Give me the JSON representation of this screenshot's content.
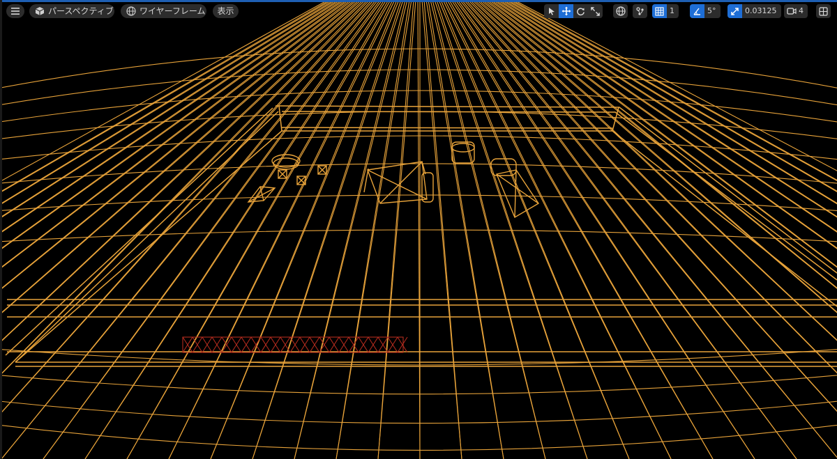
{
  "toolbar": {
    "menu_icon": "hamburger-icon",
    "perspective_label": "パースペクティブ",
    "view_mode_label": "ワイヤーフレーム",
    "show_label": "表示",
    "transform_tools": [
      "select-icon",
      "translate-icon",
      "rotate-icon",
      "scale-icon"
    ],
    "active_tool": "translate-icon",
    "grid_snap_value": "1",
    "rotation_snap_value": "5°",
    "scale_snap_value": "0.03125",
    "camera_speed_value": "4"
  },
  "colors": {
    "wireframe": "#e8a33a",
    "selected_wire": "#b32b1e",
    "accent": "#1e6ed6",
    "toolbar_bg": "#2c2c2c",
    "background": "#000000"
  }
}
